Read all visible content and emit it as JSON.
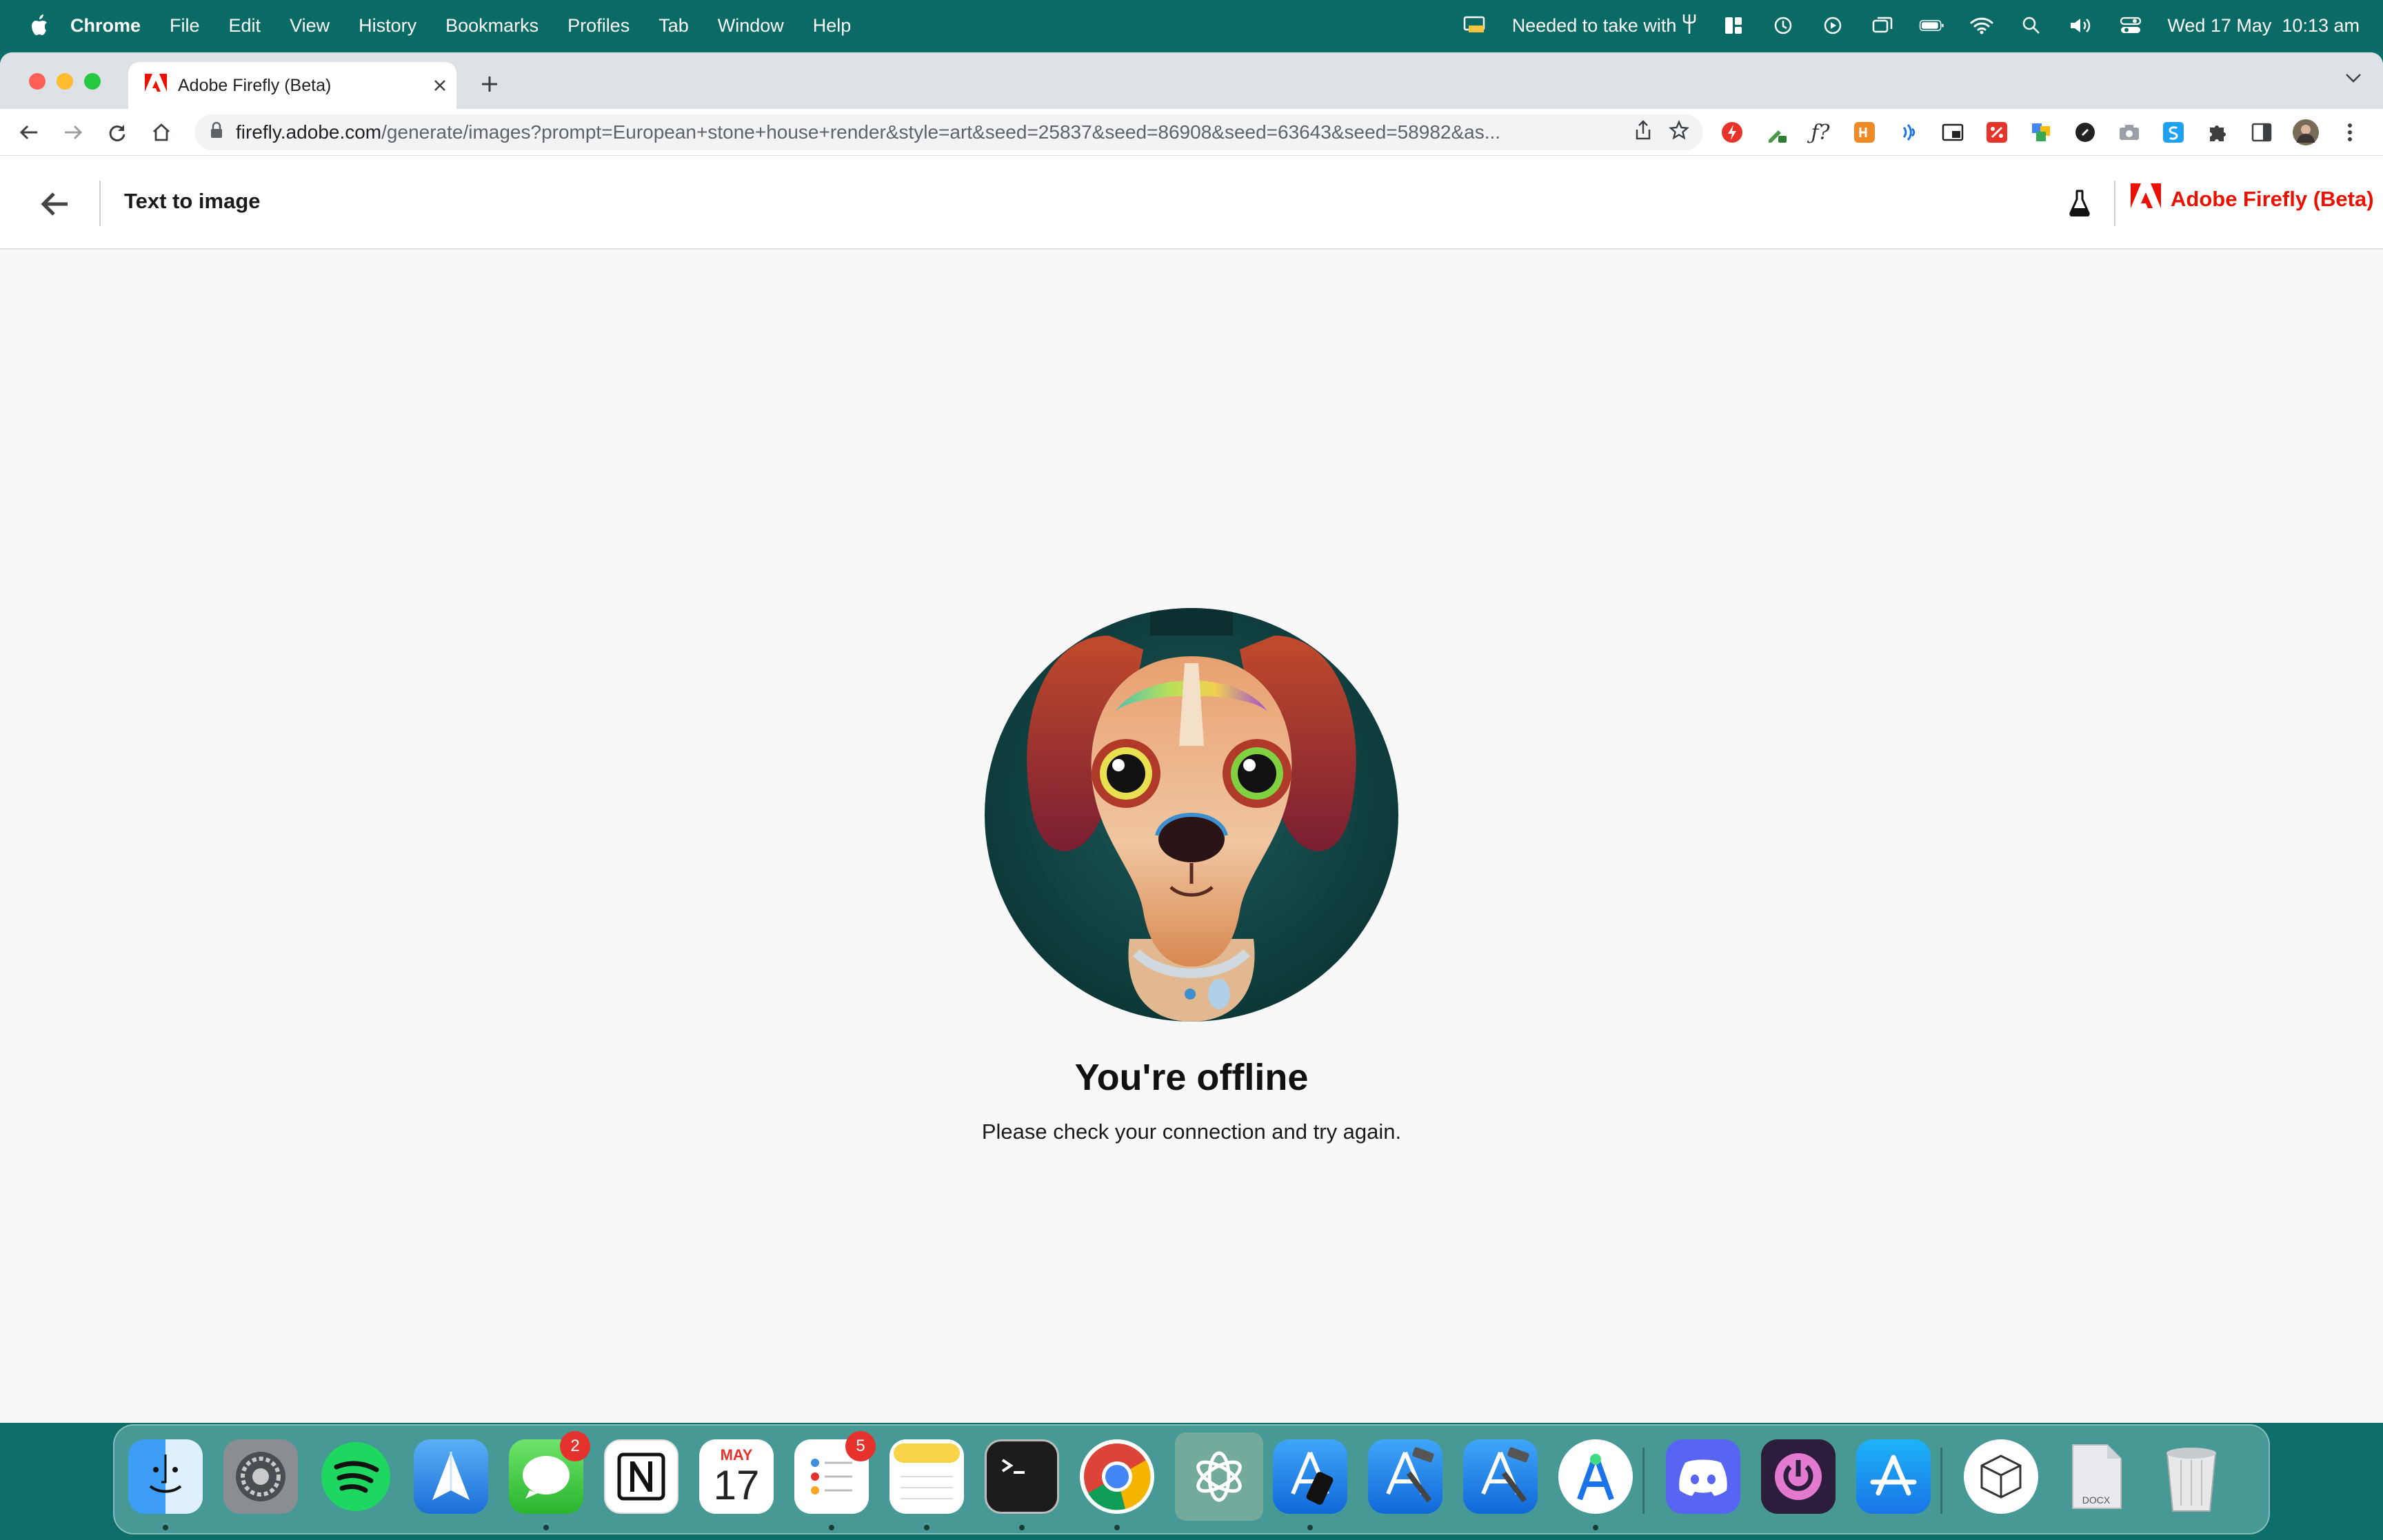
{
  "menubar": {
    "app_name": "Chrome",
    "items": [
      "File",
      "Edit",
      "View",
      "History",
      "Bookmarks",
      "Profiles",
      "Tab",
      "Window",
      "Help"
    ],
    "status_text": "Needed to take with",
    "datetime": "Wed 17 May  10:13 am"
  },
  "browser": {
    "tab_title": "Adobe Firefly (Beta)",
    "url_host": "firefly.adobe.com",
    "url_path": "/generate/images?prompt=European+stone+house+render&style=art&seed=25837&seed=86908&seed=63643&seed=58982&as..."
  },
  "app": {
    "page_title": "Text to image",
    "brand_name": "Adobe Firefly (Beta)",
    "brand_color": "#eb1000"
  },
  "offline": {
    "title": "You're offline",
    "message": "Please check your connection and try again."
  },
  "dock": {
    "messages_badge": "2",
    "reminders_badge": "5",
    "calendar_month": "MAY",
    "calendar_day": "17",
    "docx_label": "DOCX",
    "apps": [
      "finder-icon",
      "system-settings-icon",
      "spotify-icon",
      "spark-mail-icon",
      "messages-icon",
      "notion-icon",
      "calendar-icon",
      "reminders-icon",
      "notes-icon",
      "terminal-icon",
      "chrome-icon",
      "chatgpt-icon",
      "simulator-icon",
      "xcode-icon",
      "xcode-beta-icon",
      "android-studio-icon",
      "discord-icon",
      "power-app-icon",
      "app-store-icon",
      "archive-utility-icon",
      "docx-file-icon",
      "trash-icon"
    ]
  }
}
